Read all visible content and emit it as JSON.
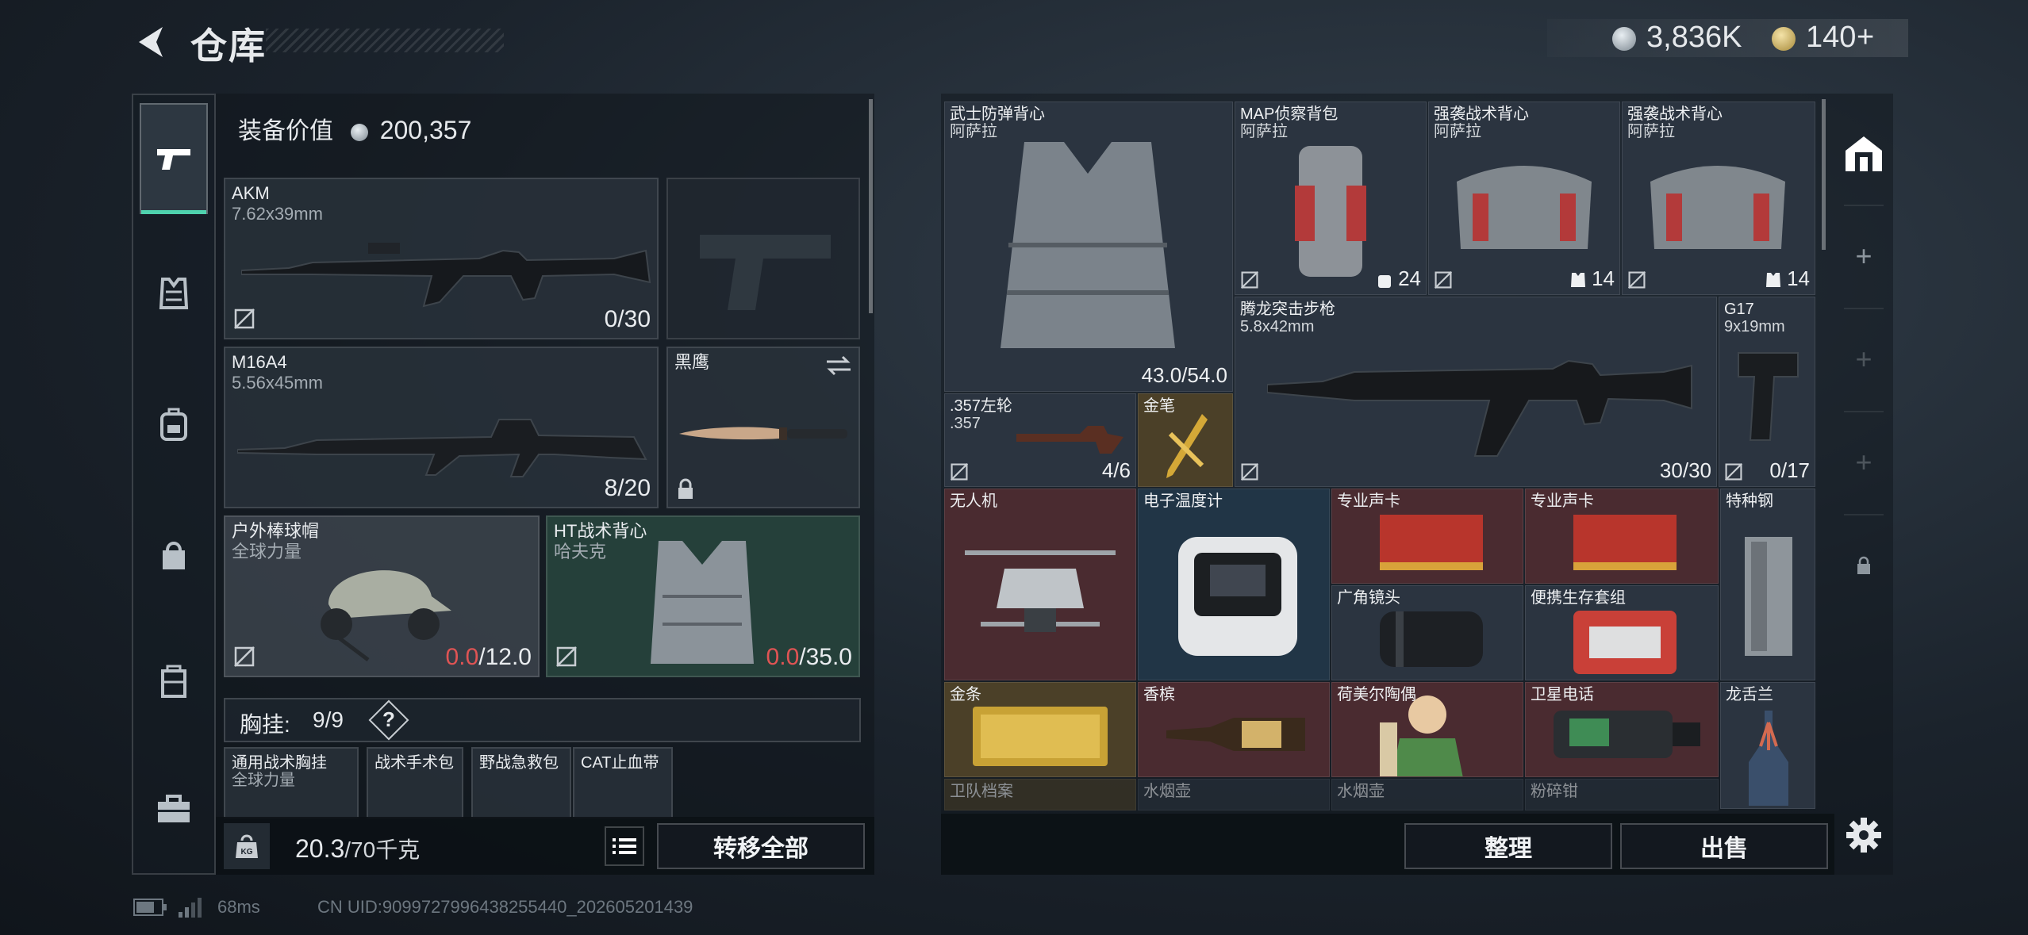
{
  "header": {
    "title": "仓库",
    "silver_amount": "3,836K",
    "gold_amount": "140",
    "gold_plus": "+"
  },
  "equipment": {
    "value_label": "装备价值",
    "value": "200,357",
    "primary_weapon": {
      "name": "AKM",
      "caliber": "7.62x39mm",
      "ammo": "0/30"
    },
    "secondary_weapon": {
      "name": "M16A4",
      "caliber": "5.56x45mm",
      "ammo": "8/20"
    },
    "melee": {
      "name": "黑鹰"
    },
    "helmet": {
      "name": "户外棒球帽",
      "brand": "全球力量",
      "durability_current": "0.0",
      "durability_max": "/12.0"
    },
    "armor": {
      "name": "HT战术背心",
      "brand": "哈夫克",
      "durability_current": "0.0",
      "durability_max": "/35.0"
    },
    "rig": {
      "label": "胸挂:",
      "count": "9/9",
      "help": "?",
      "items": [
        {
          "name": "通用战术胸挂",
          "brand": "全球力量"
        },
        {
          "name": "战术手术包"
        },
        {
          "name": "野战急救包"
        },
        {
          "name": "CAT止血带"
        }
      ]
    },
    "weight_current": "20.3",
    "weight_max": "/70千克",
    "transfer_all": "转移全部"
  },
  "stash": {
    "items": [
      {
        "name": "武士防弹背心",
        "sub": "阿萨拉",
        "count": "43.0/54.0"
      },
      {
        "name": "MAP侦察背包",
        "sub": "阿萨拉",
        "count": "24"
      },
      {
        "name": "强袭战术背心",
        "sub": "阿萨拉",
        "count": "14"
      },
      {
        "name": "强袭战术背心",
        "sub": "阿萨拉",
        "count": "14"
      },
      {
        "name": "腾龙突击步枪",
        "sub": "5.8x42mm",
        "count": "30/30"
      },
      {
        "name": "G17",
        "sub": "9x19mm",
        "count": "0/17"
      },
      {
        "name": ".357左轮",
        "sub": ".357",
        "count": "4/6"
      },
      {
        "name": "金笔"
      },
      {
        "name": "无人机"
      },
      {
        "name": "电子温度计"
      },
      {
        "name": "专业声卡"
      },
      {
        "name": "专业声卡"
      },
      {
        "name": "特种钢"
      },
      {
        "name": "广角镜头"
      },
      {
        "name": "便携生存套组"
      },
      {
        "name": "金条"
      },
      {
        "name": "香槟"
      },
      {
        "name": "荷美尔陶偶"
      },
      {
        "name": "卫星电话"
      },
      {
        "name": "龙舌兰"
      },
      {
        "name": "卫队档案"
      },
      {
        "name": "水烟壶"
      },
      {
        "name": "水烟壶"
      },
      {
        "name": "粉碎钳"
      }
    ],
    "sort_button": "整理",
    "sell_button": "出售"
  },
  "rail": {
    "add": "+"
  },
  "footer": {
    "ping": "68ms",
    "uid": "CN UID:9099727996438255440_202605201439"
  }
}
